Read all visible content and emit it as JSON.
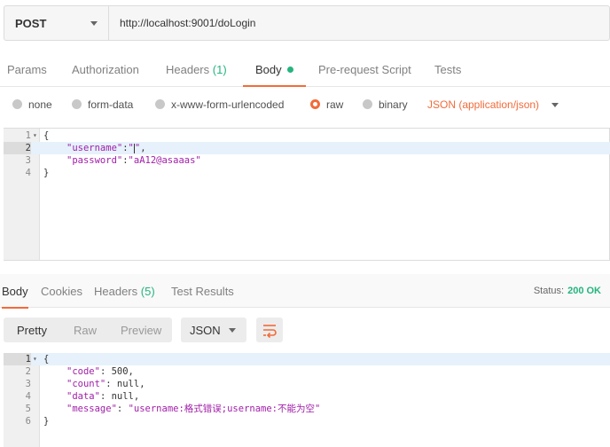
{
  "request": {
    "method": "POST",
    "url": "http://localhost:9001/doLogin",
    "tabs": [
      {
        "label": "Params"
      },
      {
        "label": "Authorization"
      },
      {
        "label": "Headers",
        "count": "(1)"
      },
      {
        "label": "Body"
      },
      {
        "label": "Pre-request Script"
      },
      {
        "label": "Tests"
      }
    ],
    "body_types": [
      "none",
      "form-data",
      "x-www-form-urlencoded",
      "raw",
      "binary"
    ],
    "content_type": "JSON (application/json)",
    "editor_lines": [
      {
        "n": "1",
        "text": "{"
      },
      {
        "n": "2",
        "key": "\"username\"",
        "sep": ":",
        "val_open": "\"",
        "val_close": "\"",
        "tail": ","
      },
      {
        "n": "3",
        "key": "\"password\"",
        "sep": ":",
        "val": "\"aA12@asaaas\""
      },
      {
        "n": "4",
        "text": "}"
      }
    ]
  },
  "response": {
    "tabs": [
      {
        "label": "Body"
      },
      {
        "label": "Cookies"
      },
      {
        "label": "Headers",
        "count": "(5)"
      },
      {
        "label": "Test Results"
      }
    ],
    "status_label": "Status:",
    "status_value": "200 OK",
    "view_modes": [
      "Pretty",
      "Raw",
      "Preview"
    ],
    "format": "JSON",
    "editor_lines": [
      {
        "n": "1",
        "text": "{"
      },
      {
        "n": "2",
        "key": "\"code\"",
        "rest": ": 500,"
      },
      {
        "n": "3",
        "key": "\"count\"",
        "rest": ": null,"
      },
      {
        "n": "4",
        "key": "\"data\"",
        "rest": ": null,"
      },
      {
        "n": "5",
        "key": "\"message\"",
        "sep": ": ",
        "val": "\"username:格式错误;username:不能为空\""
      },
      {
        "n": "6",
        "text": "}"
      }
    ]
  },
  "colors": {
    "accent": "#f26b3a",
    "green": "#26b47f",
    "string": "#a11ea8"
  },
  "icons": [
    "chevron-down-icon",
    "wrap-lines-icon",
    "fold-arrow-icon"
  ]
}
